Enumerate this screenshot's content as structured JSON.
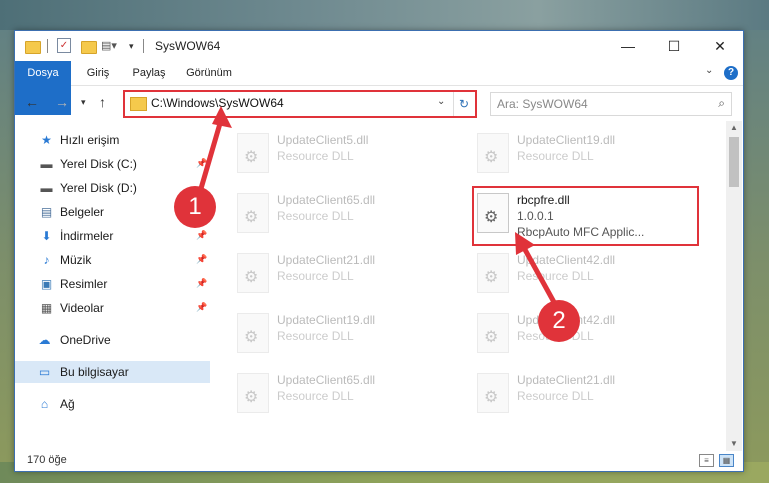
{
  "window": {
    "title": "SysWOW64",
    "minimize": "—",
    "maximize": "☐",
    "close": "✕"
  },
  "ribbon": {
    "tabs": [
      "Dosya",
      "Giriş",
      "Paylaş",
      "Görünüm"
    ]
  },
  "address": {
    "path": "C:\\Windows\\SysWOW64",
    "search_placeholder": "Ara: SysWOW64"
  },
  "nav": {
    "items": [
      {
        "label": "Hızlı erişim",
        "icon": "star-icon"
      },
      {
        "label": "Yerel Disk (C:)",
        "icon": "drive-icon",
        "pinned": true
      },
      {
        "label": "Yerel Disk (D:)",
        "icon": "drive-icon",
        "pinned": true
      },
      {
        "label": "Belgeler",
        "icon": "document-icon",
        "pinned": true
      },
      {
        "label": "İndirmeler",
        "icon": "download-icon",
        "pinned": true
      },
      {
        "label": "Müzik",
        "icon": "music-icon",
        "pinned": true
      },
      {
        "label": "Resimler",
        "icon": "picture-icon",
        "pinned": true
      },
      {
        "label": "Videolar",
        "icon": "video-icon",
        "pinned": true
      },
      {
        "label": "OneDrive",
        "icon": "cloud-icon"
      },
      {
        "label": "Bu bilgisayar",
        "icon": "computer-icon"
      },
      {
        "label": "Ağ",
        "icon": "network-icon"
      }
    ]
  },
  "files": [
    {
      "name": "UpdateClient5.dll",
      "sub": "Resource DLL"
    },
    {
      "name": "UpdateClient19.dll",
      "sub": "Resource DLL"
    },
    {
      "name": "UpdateClient65.dll",
      "sub": "Resource DLL"
    },
    {
      "name": "rbcpfre.dll",
      "sub": "1.0.0.1",
      "sub2": "RbcpAuto MFC Applic..."
    },
    {
      "name": "UpdateClient21.dll",
      "sub": "Resource DLL"
    },
    {
      "name": "UpdateClient42.dll",
      "sub": "Resource DLL"
    },
    {
      "name": "UpdateClient19.dll",
      "sub": "Resource DLL"
    },
    {
      "name": "UpdateClient42.dll",
      "sub": "Resource DLL"
    },
    {
      "name": "UpdateClient65.dll",
      "sub": "Resource DLL"
    },
    {
      "name": "UpdateClient21.dll",
      "sub": "Resource DLL"
    }
  ],
  "status": {
    "count": "170 öğe"
  },
  "badges": {
    "one": "1",
    "two": "2"
  },
  "colors": {
    "accent": "#1e6ec8",
    "highlight": "#e0333a"
  }
}
